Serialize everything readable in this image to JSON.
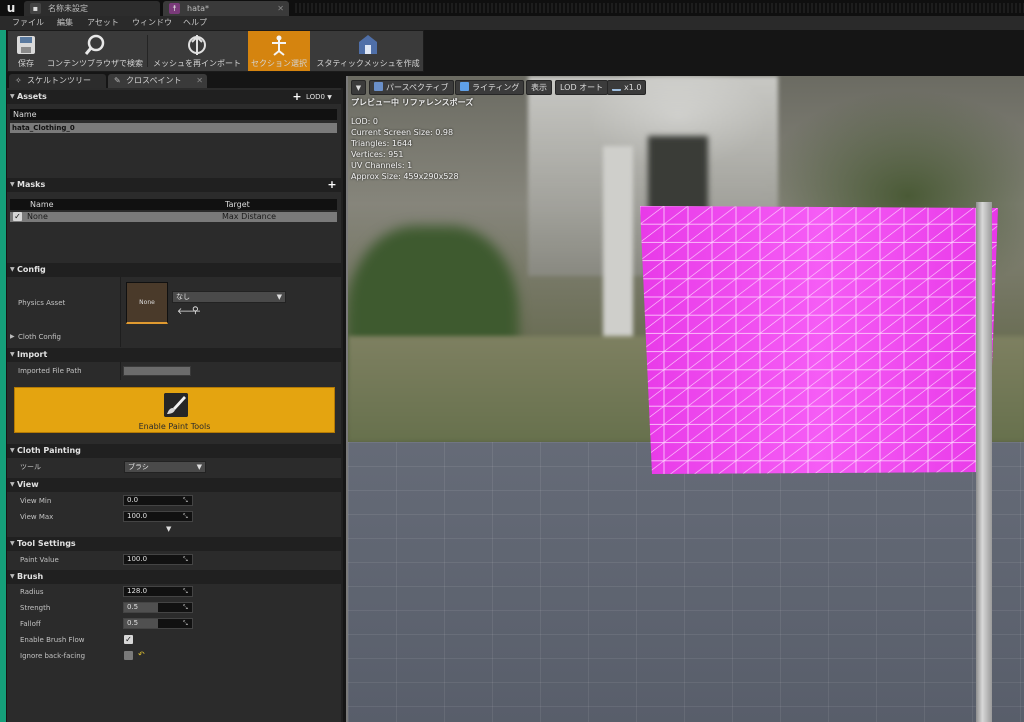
{
  "titlebar": {
    "tabs": [
      {
        "label": "名称未設定"
      },
      {
        "label": "hata*"
      }
    ]
  },
  "menu": {
    "items": [
      "ファイル",
      "編集",
      "アセット",
      "ウィンドウ",
      "ヘルプ"
    ]
  },
  "toolbar": {
    "save": "保存",
    "browse": "コンテンツブラウザで検索",
    "reimport": "メッシュを再インポート",
    "section_select": "セクション選択",
    "make_static": "スタティックメッシュを作成"
  },
  "panel_tabs": {
    "skeleton_tree": "スケルトンツリー",
    "cloth_paint": "クロスペイント"
  },
  "assets": {
    "title": "Assets",
    "lod_dropdown": "LOD0",
    "column_name": "Name",
    "selected_item": "hata_Clothing_0"
  },
  "masks": {
    "title": "Masks",
    "column_name": "Name",
    "column_target": "Target",
    "row_name": "None",
    "row_target": "Max Distance"
  },
  "config": {
    "title": "Config",
    "physics_asset_label": "Physics Asset",
    "thumbnail_text": "None",
    "physics_asset_value": "なし",
    "cloth_config_label": "Cloth Config"
  },
  "import": {
    "title": "Import",
    "imported_file_path_label": "Imported File Path",
    "enable_paint_tools": "Enable Paint Tools"
  },
  "cloth_painting": {
    "title": "Cloth Painting",
    "tool_label": "ツール",
    "tool_value": "ブラシ"
  },
  "view": {
    "title": "View",
    "view_min_label": "View Min",
    "view_min_value": "0.0",
    "view_max_label": "View Max",
    "view_max_value": "100.0"
  },
  "tool_settings": {
    "title": "Tool Settings",
    "paint_value_label": "Paint Value",
    "paint_value": "100.0"
  },
  "brush": {
    "title": "Brush",
    "radius_label": "Radius",
    "radius_value": "128.0",
    "strength_label": "Strength",
    "strength_value": "0.5",
    "strength_fraction": 0.5,
    "falloff_label": "Falloff",
    "falloff_value": "0.5",
    "falloff_fraction": 0.5,
    "enable_brush_flow_label": "Enable Brush Flow",
    "ignore_back_facing_label": "Ignore back-facing"
  },
  "viewport": {
    "perspective": "パースペクティブ",
    "lighting": "ライティング",
    "show": "表示",
    "lod_auto": "LOD オート",
    "speed": "x1.0",
    "caption": "プレビュー中 リファレンスポーズ",
    "stats": [
      "LOD: 0",
      "Current Screen Size: 0.98",
      "Triangles: 1644",
      "Vertices: 951",
      "UV Channels: 1",
      "Approx Size: 459x290x528"
    ]
  },
  "colors": {
    "accent_orange": "#d5840f",
    "paint_button": "#e4a410",
    "cloth_magenta": "#f03cf0",
    "left_edge_green": "#15a07a"
  }
}
